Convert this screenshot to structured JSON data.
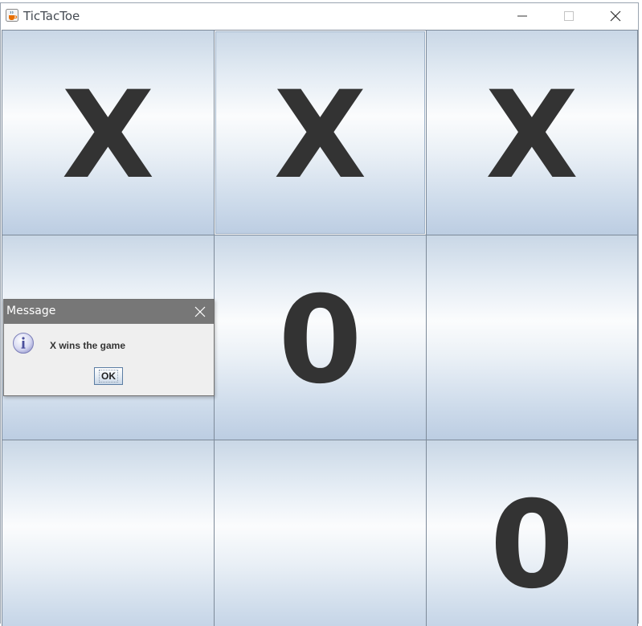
{
  "window": {
    "title": "TicTacToe",
    "icon": "java-cup-icon"
  },
  "board": {
    "cells": [
      {
        "row": 1,
        "col": 1,
        "mark": "X"
      },
      {
        "row": 1,
        "col": 2,
        "mark": "X"
      },
      {
        "row": 1,
        "col": 3,
        "mark": "X"
      },
      {
        "row": 2,
        "col": 1,
        "mark": ""
      },
      {
        "row": 2,
        "col": 2,
        "mark": "0"
      },
      {
        "row": 2,
        "col": 3,
        "mark": ""
      },
      {
        "row": 3,
        "col": 1,
        "mark": ""
      },
      {
        "row": 3,
        "col": 2,
        "mark": ""
      },
      {
        "row": 3,
        "col": 3,
        "mark": "0"
      }
    ]
  },
  "dialog": {
    "title": "Message",
    "icon": "info-icon",
    "message": "X wins the game",
    "ok_label": "OK"
  },
  "colors": {
    "mark": "#333333",
    "dialog_title_bg": "#777777",
    "cell_border": "#7d8a99"
  }
}
